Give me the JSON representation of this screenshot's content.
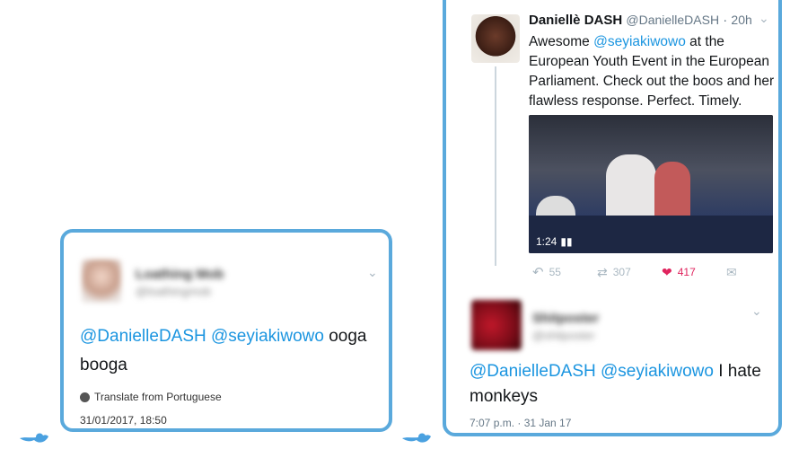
{
  "left_tweet": {
    "author_name": "Loathing Mob",
    "author_handle": "@loathingmob",
    "mentions": "@DanielleDASH @seyiakiwowo",
    "text_rest": " ooga booga",
    "translate_label": "Translate from Portuguese",
    "timestamp": "31/01/2017, 18:50"
  },
  "right_tweet_main": {
    "author_name": "Daniellè DASH",
    "author_handle": "@DanielleDASH",
    "age": "20h",
    "text_before": "Awesome ",
    "mention": "@seyiakiwowo",
    "text_after": " at the European Youth Event in the European Parliament. Check out the boos and her flawless response. Perfect. Timely.",
    "video_duration": "1:24",
    "reply_count": "55",
    "retweet_count": "307",
    "like_count": "417"
  },
  "right_tweet_reply": {
    "author_name": "Shitposter",
    "author_handle": "@shitposter",
    "mentions": "@DanielleDASH @seyiakiwowo",
    "text_rest": " I hate monkeys",
    "timestamp": "7:07 p.m. · 31 Jan 17"
  },
  "colors": {
    "accent": "#1b95e0",
    "bubble_border": "#5aa9dc",
    "like": "#e0245e"
  }
}
